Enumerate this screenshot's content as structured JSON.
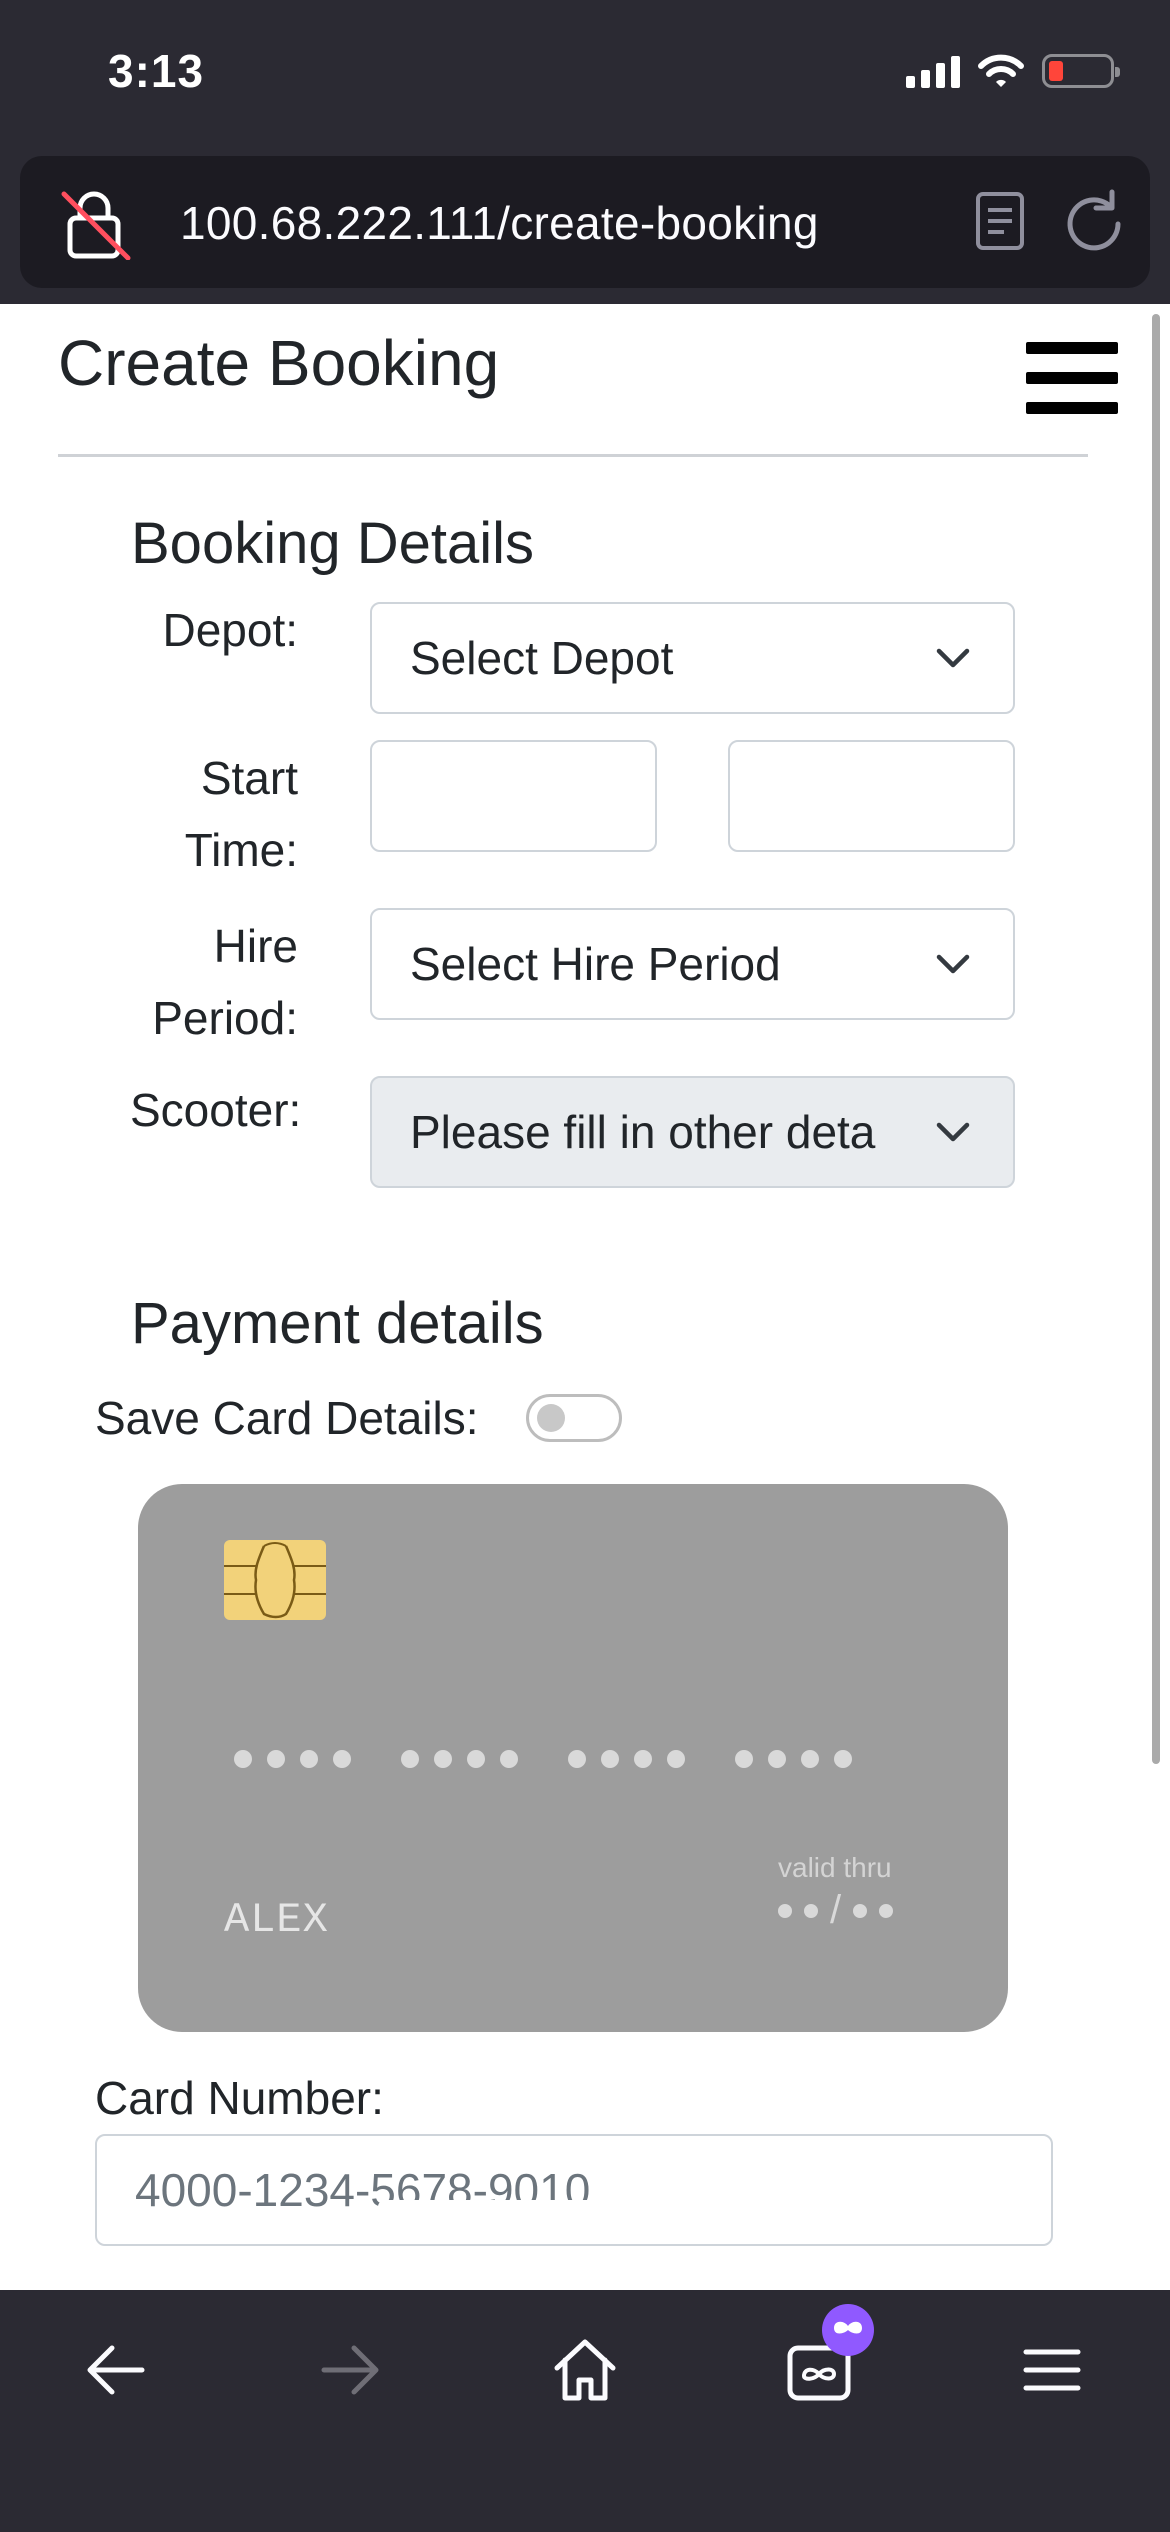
{
  "status_bar": {
    "time": "3:13"
  },
  "browser": {
    "url": "100.68.222.111/create-booking"
  },
  "page": {
    "title": "Create Booking",
    "booking_section": {
      "title": "Booking Details",
      "depot_label": "Depot:",
      "depot_value": "Select Depot",
      "start_time_label_1": "Start",
      "start_time_label_2": "Time:",
      "start_date_value": "",
      "start_hour_value": "",
      "hire_period_label_1": "Hire",
      "hire_period_label_2": "Period:",
      "hire_period_value": "Select Hire Period",
      "scooter_label": "Scooter:",
      "scooter_value": "Please fill in other deta"
    },
    "payment_section": {
      "title": "Payment details",
      "save_card_label": "Save Card Details:",
      "save_card_enabled": false,
      "card_preview": {
        "name": "ALEX",
        "valid_thru_label": "valid thru",
        "valid_thru_separator": "/"
      },
      "card_number_label": "Card Number:",
      "card_number_placeholder": "4000-1234-5678-9010"
    }
  },
  "colors": {
    "browser_chrome": "#2b2a33",
    "url_bar": "#1c1b22",
    "card_bg": "#9d9d9d",
    "chip": "#f2d27a",
    "badge": "#9059ff",
    "battery_low": "#ff453a"
  },
  "icons": {
    "lock": "insecure-lock-icon",
    "reader": "reader-view-icon",
    "reload": "reload-icon",
    "menu": "hamburger-menu-icon",
    "back": "back-arrow-icon",
    "forward": "forward-arrow-icon",
    "home": "home-icon",
    "tabs": "private-tabs-icon",
    "app_menu": "app-menu-icon"
  }
}
